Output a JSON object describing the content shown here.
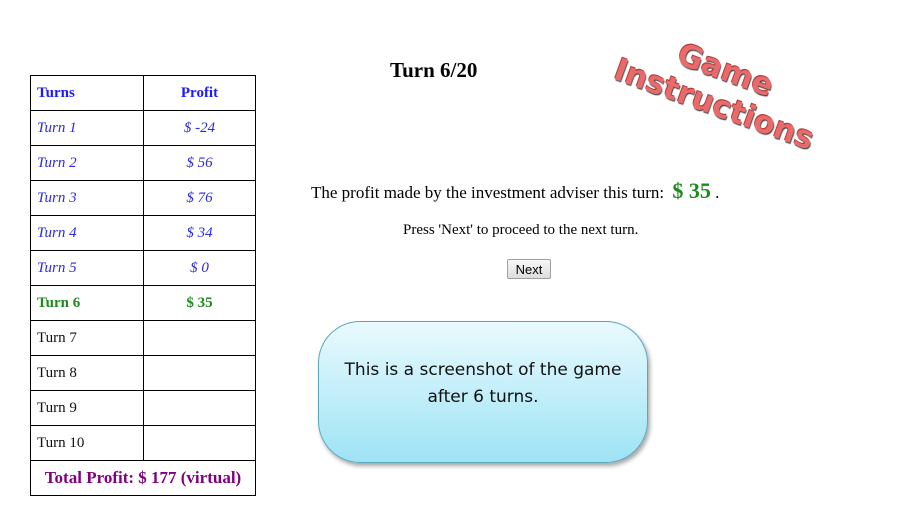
{
  "turns_table": {
    "headers": {
      "turn": "Turns",
      "profit": "Profit"
    },
    "past_rows": [
      {
        "turn": "Turn 1",
        "profit": "$ -24"
      },
      {
        "turn": "Turn 2",
        "profit": "$ 56"
      },
      {
        "turn": "Turn 3",
        "profit": "$ 76"
      },
      {
        "turn": "Turn 4",
        "profit": "$ 34"
      },
      {
        "turn": "Turn 5",
        "profit": "$ 0"
      }
    ],
    "current_row": {
      "turn": "Turn 6",
      "profit": "$ 35"
    },
    "future_rows": [
      {
        "turn": "Turn 7",
        "profit": ""
      },
      {
        "turn": "Turn 8",
        "profit": ""
      },
      {
        "turn": "Turn 9",
        "profit": ""
      },
      {
        "turn": "Turn 10",
        "profit": ""
      }
    ],
    "total": "Total Profit: $ 177 (virtual)"
  },
  "turn_counter": "Turn 6/20",
  "instructions": {
    "line1": "Game",
    "line2": "Instructions"
  },
  "profit_message": {
    "text": "The profit made by the investment adviser this turn:",
    "value": "$ 35",
    "suffix": "."
  },
  "next_hint": "Press 'Next' to proceed to the next turn.",
  "next_button": "Next",
  "callout": "This is a screenshot  of the game after 6 turns.",
  "colors": {
    "past": "#2b2be0",
    "current": "#1e8a1e",
    "total": "#800080",
    "instructions": "#e86a6a"
  }
}
